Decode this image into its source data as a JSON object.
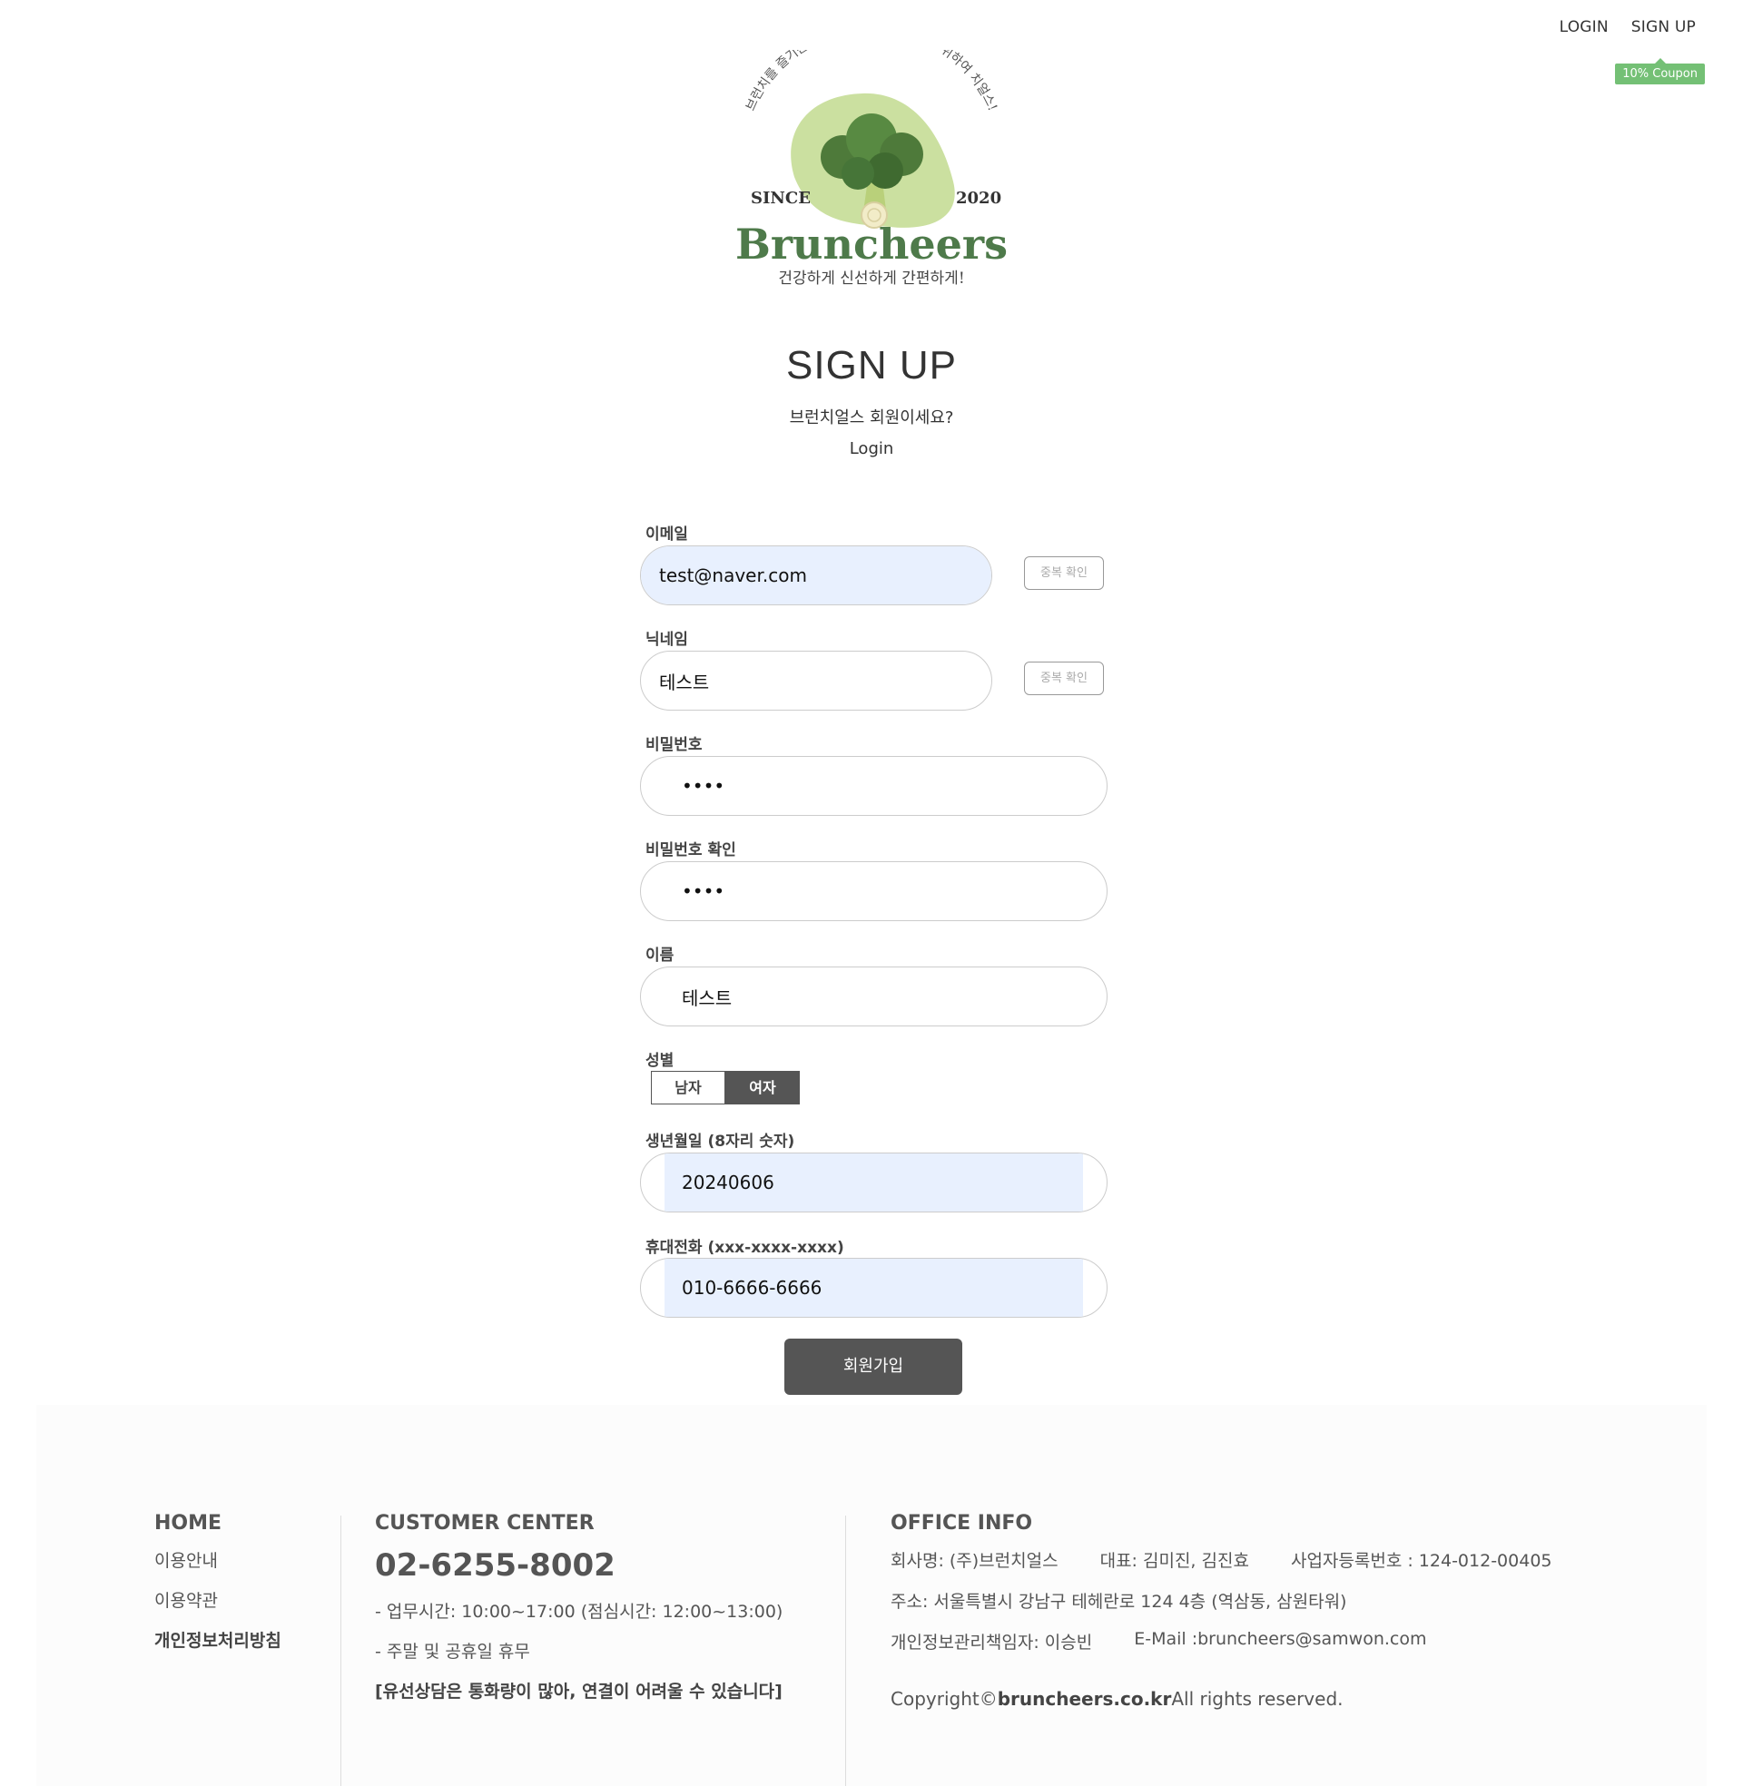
{
  "nav": {
    "login": "LOGIN",
    "signup": "SIGN UP",
    "coupon": "10% Coupon"
  },
  "logo": {
    "arc_text": "브런치를 즐기는 브런치어, 당신의 건강을 위하여 치얼스!",
    "since": "SINCE",
    "year": "2020",
    "brand": "Bruncheers",
    "slogan": "건강하게 신선하게 간편하게!"
  },
  "page": {
    "title": "SIGN UP",
    "subtitle": "브런치얼스 회원이세요?",
    "login_link": "Login"
  },
  "form": {
    "email_label": "이메일",
    "email_value": "test@naver.com",
    "dup_check": "중복 확인",
    "nickname_label": "닉네임",
    "nickname_value": "테스트",
    "password_label": "비밀번호",
    "password_value": "1234",
    "password_confirm_label": "비밀번호 확인",
    "password_confirm_value": "1234",
    "name_label": "이름",
    "name_value": "테스트",
    "gender_label": "성별",
    "gender_male": "남자",
    "gender_female": "여자",
    "gender_selected": "여자",
    "birth_label": "생년월일 (8자리 숫자)",
    "birth_value": "20240606",
    "phone_label": "휴대전화 (xxx-xxxx-xxxx)",
    "phone_value": "010-6666-6666",
    "submit": "회원가입"
  },
  "footer": {
    "home": {
      "title": "HOME",
      "items": [
        "이용안내",
        "이용약관",
        "개인정보처리방침"
      ]
    },
    "customer": {
      "title": "CUSTOMER CENTER",
      "phone": "02-6255-8002",
      "hours": "- 업무시간: 10:00~17:00 (점심시간: 12:00~13:00)",
      "holiday": "- 주말 및 공휴일 휴무",
      "notice": "[유선상담은 통화량이 많아, 연결이 어려울 수 있습니다]"
    },
    "office": {
      "title": "OFFICE INFO",
      "company": "회사명: (주)브런치얼스",
      "ceo": "대표: 김미진, 김진효",
      "biz_no": "사업자등록번호 : 124-012-00405",
      "address": "주소: 서울특별시 강남구 테헤란로 124 4층 (역삼동, 삼원타워)",
      "privacy_officer": "개인정보관리책임자: 이승빈",
      "email": "E-Mail :bruncheers@samwon.com",
      "copyright_prefix": "Copyright©",
      "copyright_domain": "bruncheers.co.kr",
      "copyright_suffix": "All rights reserved."
    }
  },
  "colors": {
    "brand_green": "#4e7a4a",
    "coupon_green": "#74c075",
    "dark_button": "#555555",
    "autofill": "#e8f0fe"
  }
}
